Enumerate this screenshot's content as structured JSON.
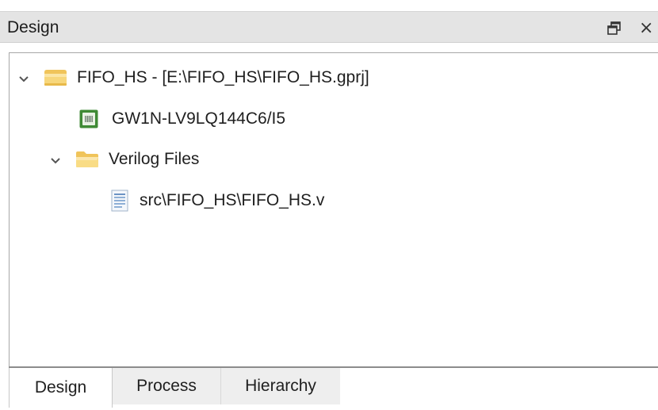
{
  "panel": {
    "title": "Design",
    "restore_icon": "restore-window-icon",
    "close_glyph": "×"
  },
  "tree": {
    "project": {
      "label": "FIFO_HS - [E:\\FIFO_HS\\FIFO_HS.gprj]",
      "expanded": true,
      "icon": "project-folder-icon"
    },
    "device": {
      "label": "GW1N-LV9LQ144C6/I5",
      "icon": "chip-icon"
    },
    "verilog_folder": {
      "label": "Verilog Files",
      "expanded": true,
      "icon": "folder-icon"
    },
    "verilog_file": {
      "label": "src\\FIFO_HS\\FIFO_HS.v",
      "icon": "verilog-file-icon"
    }
  },
  "tabs": [
    {
      "label": "Design",
      "active": true
    },
    {
      "label": "Process",
      "active": false
    },
    {
      "label": "Hierarchy",
      "active": false
    }
  ],
  "colors": {
    "titlebar_bg": "#e4e4e4",
    "folder_yellow": "#f5d36a",
    "chip_green": "#4a9a3c",
    "tab_inactive_bg": "#eeeeee"
  }
}
